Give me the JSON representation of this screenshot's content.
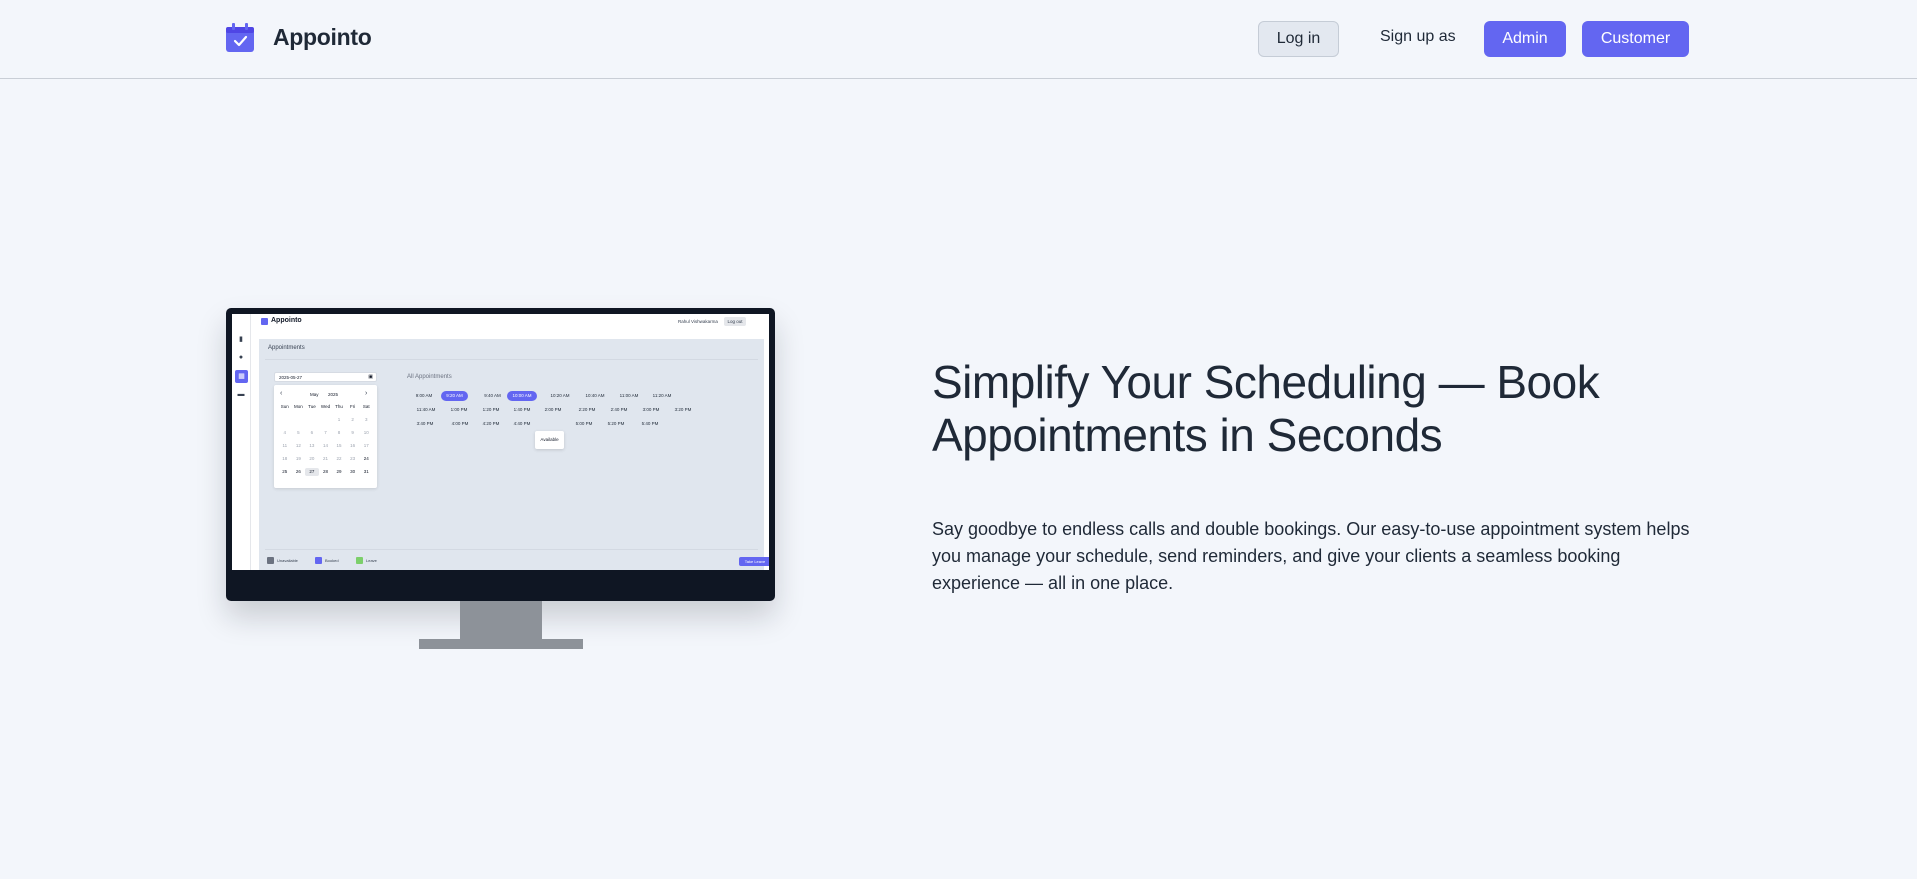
{
  "header": {
    "brand": "Appointo",
    "login_label": "Log in",
    "signup_label": "Sign up as",
    "admin_label": "Admin",
    "customer_label": "Customer"
  },
  "colors": {
    "accent": "#6366f1",
    "background": "#f3f6fb",
    "text": "#1f2937"
  },
  "hero": {
    "title": "Simplify Your Scheduling — Book Appointments in Seconds",
    "description": "Say goodbye to endless calls and double bookings. Our easy-to-use appointment system helps you manage your schedule, send reminders, and give your clients a seamless booking experience — all in one place."
  },
  "mockup": {
    "brand": "Appointo",
    "user": "Rahul Vishwakarma",
    "logout": "Log out",
    "page_title": "Appointments",
    "date_value": "2025-05-27",
    "month": "May",
    "year": "2025",
    "weekdays": [
      "Sun",
      "Mon",
      "Tue",
      "Wed",
      "Thu",
      "Fri",
      "Sat"
    ],
    "all_appointments": "All Appointments",
    "tooltip": "Available",
    "take_leave": "Take Leave",
    "legend": {
      "unavailable": "Unavailable",
      "booked": "Booked",
      "leave": "Leave"
    },
    "slots": [
      "9:00 AM",
      "9:20 AM",
      "9:40 AM",
      "10:00 AM",
      "10:20 AM",
      "10:40 AM",
      "11:00 AM",
      "11:20 AM",
      "11:40 AM",
      "1:00 PM",
      "1:20 PM",
      "1:40 PM",
      "2:00 PM",
      "2:20 PM",
      "2:40 PM",
      "3:00 PM",
      "3:20 PM",
      "3:40 PM",
      "4:00 PM",
      "4:20 PM",
      "4:40 PM",
      "5:00 PM",
      "5:20 PM",
      "5:40 PM"
    ]
  }
}
